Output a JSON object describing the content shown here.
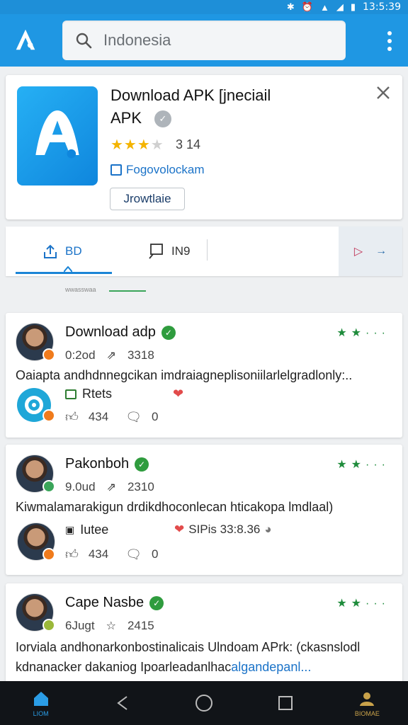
{
  "status_bar": {
    "time": "13:5:39"
  },
  "search": {
    "placeholder": "Indonesia"
  },
  "hero": {
    "title_line1": "Download APK [jneciail",
    "title_line2": "APK",
    "rating_count": "3  14",
    "developer_link": "Fogovolockam",
    "download_button": "Jrowtlaie"
  },
  "tabs": {
    "tab1": "BD",
    "tab2": "IN9",
    "small_text": "wwasswaa"
  },
  "posts": [
    {
      "name": "Download adp",
      "age": "0:2od",
      "shares": "3318",
      "body_lines": [
        "Oaiapta andhdnnegcikan imdraiagneplisoniilarlelgradlonly:.."
      ],
      "attachment": "Rtets",
      "likes": "434",
      "comments": "0"
    },
    {
      "name": "Pakonboh",
      "age": "9.0ud",
      "shares": "2310",
      "body_lines": [
        "Kiwmalamarakigun drdikdhoconlecan hticakopa lmdlaal)"
      ],
      "attachment": "Iutee",
      "extra": "SIPis 33:8.36",
      "likes": "434",
      "comments": "0"
    },
    {
      "name": "Cape Nasbe",
      "age": "6Jugt",
      "shares": "2415",
      "body_lines": [
        "Iorviala andhonarkonbostinalicais Ulndoam APrk: (ckasnslodl",
        "kdnanacker dakaniog Ipoarleadanlhac"
      ],
      "body_link": "algandepanl..."
    }
  ],
  "bottom_nav": {
    "home_label": "LIOM",
    "profile_label": "BIOMAE"
  },
  "colors": {
    "app_bar": "#1f97e3",
    "accent_blue": "#1b73c8",
    "star_gold": "#f4b400",
    "verified_green": "#2f9c3e"
  }
}
